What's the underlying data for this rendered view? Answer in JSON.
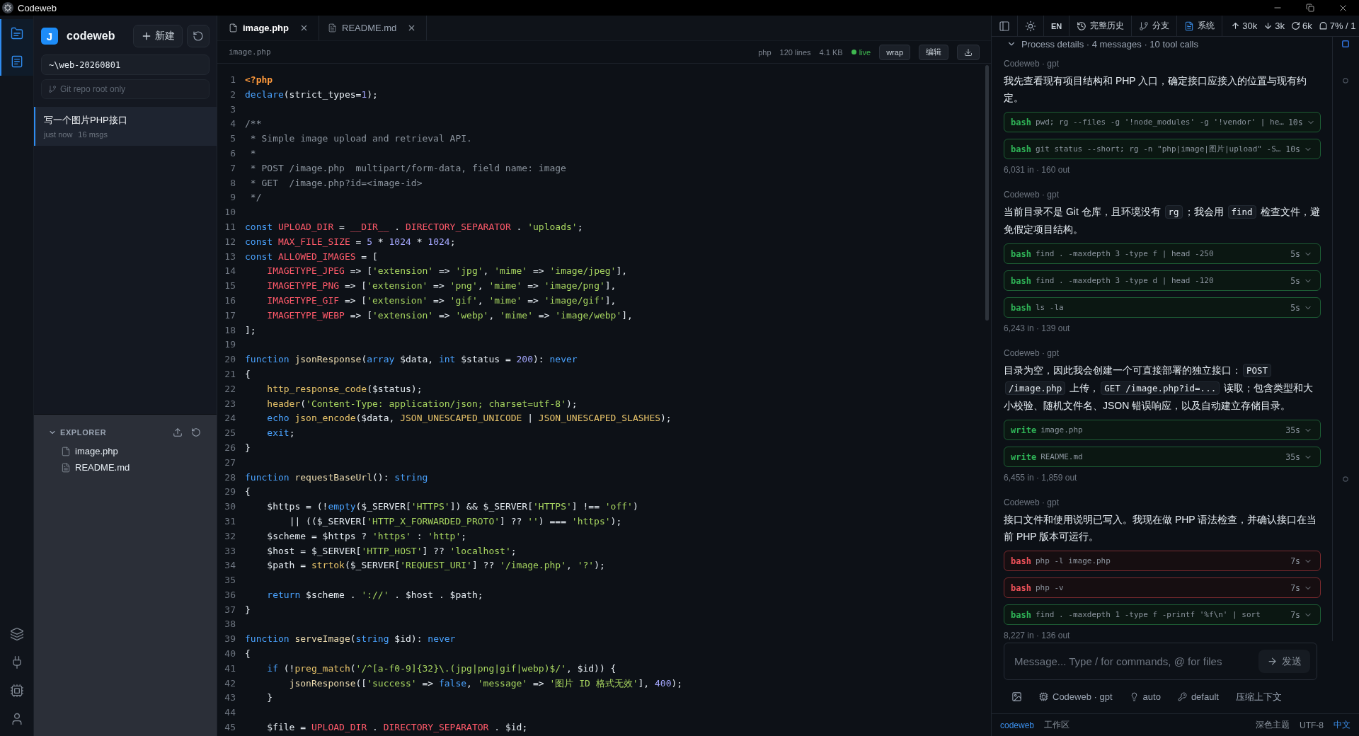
{
  "window": {
    "title": "Codeweb"
  },
  "activity_bar": {
    "top": [
      {
        "selected": true
      },
      {
        "selected": true
      }
    ],
    "bottom": [
      {
        "selected": false
      },
      {
        "selected": false
      },
      {
        "selected": false
      },
      {
        "selected": false
      }
    ]
  },
  "sidebar": {
    "logo": "J",
    "name": "codeweb",
    "new_button": "新建",
    "path_field": {
      "value": "~\\web-20260801"
    },
    "git_field": {
      "placeholder": "Git repo root only"
    },
    "sessions": [
      {
        "title": "写一个图片PHP接口",
        "time": "just now",
        "count": "16 msgs",
        "selected": true
      }
    ],
    "explorer": {
      "title": "EXPLORER",
      "expanded": true,
      "files": [
        {
          "name": "image.php",
          "kind": "php"
        },
        {
          "name": "README.md",
          "kind": "markdown"
        }
      ]
    }
  },
  "editor": {
    "tabs": [
      {
        "label": "image.php",
        "kind": "php",
        "selected": true
      },
      {
        "label": "README.md",
        "kind": "markdown",
        "selected": false
      }
    ],
    "path": "image.php",
    "info": [
      "php",
      "120 lines",
      "4.1 KB"
    ],
    "live": {
      "label": "live",
      "on": true
    },
    "buttons": [
      "wrap",
      "编辑"
    ],
    "lines": [
      {
        "number": "1",
        "tokens": [
          {
            "kind": "tag",
            "text": "<?php"
          }
        ]
      },
      {
        "number": "2",
        "tokens": [
          {
            "kind": "kw",
            "text": "declare"
          },
          {
            "kind": "p",
            "text": "(strict_types="
          },
          {
            "kind": "num",
            "text": "1"
          },
          {
            "kind": "p",
            "text": ");"
          }
        ]
      },
      {
        "number": "3"
      },
      {
        "number": "4",
        "tokens": [
          {
            "kind": "cm",
            "text": "/**"
          }
        ]
      },
      {
        "number": "5",
        "tokens": [
          {
            "kind": "cm",
            "text": " * Simple image upload and retrieval API."
          }
        ]
      },
      {
        "number": "6",
        "tokens": [
          {
            "kind": "cm",
            "text": " *"
          }
        ]
      },
      {
        "number": "7",
        "tokens": [
          {
            "kind": "cm",
            "text": " * POST /image.php  multipart/form-data, field name: image"
          }
        ]
      },
      {
        "number": "8",
        "tokens": [
          {
            "kind": "cm",
            "text": " * GET  /image.php?id=<image-id>"
          }
        ]
      },
      {
        "number": "9",
        "tokens": [
          {
            "kind": "cm",
            "text": " */"
          }
        ]
      },
      {
        "number": "10"
      },
      {
        "number": "11",
        "tokens": [
          {
            "kind": "kw",
            "text": "const"
          },
          {
            "kind": "const",
            "text": " UPLOAD_DIR"
          },
          {
            "kind": "p",
            "text": " = "
          },
          {
            "kind": "const",
            "text": "__DIR__"
          },
          {
            "kind": "p",
            "text": " . "
          },
          {
            "kind": "const",
            "text": "DIRECTORY_SEPARATOR"
          },
          {
            "kind": "p",
            "text": " . "
          },
          {
            "kind": "str",
            "text": "'uploads'"
          },
          {
            "kind": "p",
            "text": ";"
          }
        ]
      },
      {
        "number": "12",
        "tokens": [
          {
            "kind": "kw",
            "text": "const"
          },
          {
            "kind": "const",
            "text": " MAX_FILE_SIZE"
          },
          {
            "kind": "p",
            "text": " = "
          },
          {
            "kind": "num",
            "text": "5"
          },
          {
            "kind": "p",
            "text": " * "
          },
          {
            "kind": "num",
            "text": "1024"
          },
          {
            "kind": "p",
            "text": " * "
          },
          {
            "kind": "num",
            "text": "1024"
          },
          {
            "kind": "p",
            "text": ";"
          }
        ]
      },
      {
        "number": "13",
        "tokens": [
          {
            "kind": "kw",
            "text": "const"
          },
          {
            "kind": "const",
            "text": " ALLOWED_IMAGES"
          },
          {
            "kind": "p",
            "text": " = ["
          }
        ]
      },
      {
        "number": "14",
        "tokens": [
          {
            "kind": "const",
            "text": "    IMAGETYPE_JPEG"
          },
          {
            "kind": "p",
            "text": " => ["
          },
          {
            "kind": "str",
            "text": "'extension'"
          },
          {
            "kind": "p",
            "text": " => "
          },
          {
            "kind": "str",
            "text": "'jpg'"
          },
          {
            "kind": "p",
            "text": ", "
          },
          {
            "kind": "str",
            "text": "'mime'"
          },
          {
            "kind": "p",
            "text": " => "
          },
          {
            "kind": "str",
            "text": "'image/jpeg'"
          },
          {
            "kind": "p",
            "text": "],"
          }
        ]
      },
      {
        "number": "15",
        "tokens": [
          {
            "kind": "const",
            "text": "    IMAGETYPE_PNG"
          },
          {
            "kind": "p",
            "text": " => ["
          },
          {
            "kind": "str",
            "text": "'extension'"
          },
          {
            "kind": "p",
            "text": " => "
          },
          {
            "kind": "str",
            "text": "'png'"
          },
          {
            "kind": "p",
            "text": ", "
          },
          {
            "kind": "str",
            "text": "'mime'"
          },
          {
            "kind": "p",
            "text": " => "
          },
          {
            "kind": "str",
            "text": "'image/png'"
          },
          {
            "kind": "p",
            "text": "],"
          }
        ]
      },
      {
        "number": "16",
        "tokens": [
          {
            "kind": "const",
            "text": "    IMAGETYPE_GIF"
          },
          {
            "kind": "p",
            "text": " => ["
          },
          {
            "kind": "str",
            "text": "'extension'"
          },
          {
            "kind": "p",
            "text": " => "
          },
          {
            "kind": "str",
            "text": "'gif'"
          },
          {
            "kind": "p",
            "text": ", "
          },
          {
            "kind": "str",
            "text": "'mime'"
          },
          {
            "kind": "p",
            "text": " => "
          },
          {
            "kind": "str",
            "text": "'image/gif'"
          },
          {
            "kind": "p",
            "text": "],"
          }
        ]
      },
      {
        "number": "17",
        "tokens": [
          {
            "kind": "const",
            "text": "    IMAGETYPE_WEBP"
          },
          {
            "kind": "p",
            "text": " => ["
          },
          {
            "kind": "str",
            "text": "'extension'"
          },
          {
            "kind": "p",
            "text": " => "
          },
          {
            "kind": "str",
            "text": "'webp'"
          },
          {
            "kind": "p",
            "text": ", "
          },
          {
            "kind": "str",
            "text": "'mime'"
          },
          {
            "kind": "p",
            "text": " => "
          },
          {
            "kind": "str",
            "text": "'image/webp'"
          },
          {
            "kind": "p",
            "text": "],"
          }
        ]
      },
      {
        "number": "18",
        "tokens": [
          {
            "kind": "p",
            "text": "];"
          }
        ]
      },
      {
        "number": "19"
      },
      {
        "number": "20",
        "tokens": [
          {
            "kind": "kw",
            "text": "function"
          },
          {
            "kind": "def",
            "text": " jsonResponse"
          },
          {
            "kind": "p",
            "text": "("
          },
          {
            "kind": "kw",
            "text": "array"
          },
          {
            "kind": "p",
            "text": " $data, "
          },
          {
            "kind": "kw",
            "text": "int"
          },
          {
            "kind": "p",
            "text": " $status = "
          },
          {
            "kind": "num",
            "text": "200"
          },
          {
            "kind": "p",
            "text": "): "
          },
          {
            "kind": "kw",
            "text": "never"
          }
        ]
      },
      {
        "number": "21",
        "tokens": [
          {
            "kind": "p",
            "text": "{"
          }
        ]
      },
      {
        "number": "22",
        "tokens": [
          {
            "kind": "fn",
            "text": "    http_response_code"
          },
          {
            "kind": "p",
            "text": "($status);"
          }
        ]
      },
      {
        "number": "23",
        "tokens": [
          {
            "kind": "fn",
            "text": "    header"
          },
          {
            "kind": "p",
            "text": "("
          },
          {
            "kind": "str",
            "text": "'Content-Type: application/json; charset=utf-8'"
          },
          {
            "kind": "p",
            "text": ");"
          }
        ]
      },
      {
        "number": "24",
        "tokens": [
          {
            "kind": "kw",
            "text": "    echo"
          },
          {
            "kind": "fn",
            "text": " json_encode"
          },
          {
            "kind": "p",
            "text": "($data, "
          },
          {
            "kind": "fn",
            "text": "JSON_UNESCAPED_UNICODE"
          },
          {
            "kind": "p",
            "text": " | "
          },
          {
            "kind": "fn",
            "text": "JSON_UNESCAPED_SLASHES"
          },
          {
            "kind": "p",
            "text": ");"
          }
        ]
      },
      {
        "number": "25",
        "tokens": [
          {
            "kind": "kw",
            "text": "    exit"
          },
          {
            "kind": "p",
            "text": ";"
          }
        ]
      },
      {
        "number": "26",
        "tokens": [
          {
            "kind": "p",
            "text": "}"
          }
        ]
      },
      {
        "number": "27"
      },
      {
        "number": "28",
        "tokens": [
          {
            "kind": "kw",
            "text": "function"
          },
          {
            "kind": "def",
            "text": " requestBaseUrl"
          },
          {
            "kind": "p",
            "text": "(): "
          },
          {
            "kind": "kw",
            "text": "string"
          }
        ]
      },
      {
        "number": "29",
        "tokens": [
          {
            "kind": "p",
            "text": "{"
          }
        ]
      },
      {
        "number": "30",
        "tokens": [
          {
            "kind": "p",
            "text": "    $https = (!"
          },
          {
            "kind": "kw",
            "text": "empty"
          },
          {
            "kind": "p",
            "text": "($_SERVER["
          },
          {
            "kind": "str",
            "text": "'HTTPS'"
          },
          {
            "kind": "p",
            "text": "]) && $_SERVER["
          },
          {
            "kind": "str",
            "text": "'HTTPS'"
          },
          {
            "kind": "p",
            "text": "] !== "
          },
          {
            "kind": "str",
            "text": "'off'"
          },
          {
            "kind": "p",
            "text": ")"
          }
        ]
      },
      {
        "number": "31",
        "tokens": [
          {
            "kind": "p",
            "text": "        || (($_SERVER["
          },
          {
            "kind": "str",
            "text": "'HTTP_X_FORWARDED_PROTO'"
          },
          {
            "kind": "p",
            "text": "] ?? "
          },
          {
            "kind": "str",
            "text": "''"
          },
          {
            "kind": "p",
            "text": ") === "
          },
          {
            "kind": "str",
            "text": "'https'"
          },
          {
            "kind": "p",
            "text": ");"
          }
        ]
      },
      {
        "number": "32",
        "tokens": [
          {
            "kind": "p",
            "text": "    $scheme = $https ? "
          },
          {
            "kind": "str",
            "text": "'https'"
          },
          {
            "kind": "p",
            "text": " : "
          },
          {
            "kind": "str",
            "text": "'http'"
          },
          {
            "kind": "p",
            "text": ";"
          }
        ]
      },
      {
        "number": "33",
        "tokens": [
          {
            "kind": "p",
            "text": "    $host = $_SERVER["
          },
          {
            "kind": "str",
            "text": "'HTTP_HOST'"
          },
          {
            "kind": "p",
            "text": "] ?? "
          },
          {
            "kind": "str",
            "text": "'localhost'"
          },
          {
            "kind": "p",
            "text": ";"
          }
        ]
      },
      {
        "number": "34",
        "tokens": [
          {
            "kind": "p",
            "text": "    $path = "
          },
          {
            "kind": "fn",
            "text": "strtok"
          },
          {
            "kind": "p",
            "text": "($_SERVER["
          },
          {
            "kind": "str",
            "text": "'REQUEST_URI'"
          },
          {
            "kind": "p",
            "text": "] ?? "
          },
          {
            "kind": "str",
            "text": "'/image.php'"
          },
          {
            "kind": "p",
            "text": ", "
          },
          {
            "kind": "str",
            "text": "'?'"
          },
          {
            "kind": "p",
            "text": ");"
          }
        ]
      },
      {
        "number": "35"
      },
      {
        "number": "36",
        "tokens": [
          {
            "kind": "kw",
            "text": "    return"
          },
          {
            "kind": "p",
            "text": " $scheme . "
          },
          {
            "kind": "str",
            "text": "'://'"
          },
          {
            "kind": "p",
            "text": " . $host . $path;"
          }
        ]
      },
      {
        "number": "37",
        "tokens": [
          {
            "kind": "p",
            "text": "}"
          }
        ]
      },
      {
        "number": "38"
      },
      {
        "number": "39",
        "tokens": [
          {
            "kind": "kw",
            "text": "function"
          },
          {
            "kind": "def",
            "text": " serveImage"
          },
          {
            "kind": "p",
            "text": "("
          },
          {
            "kind": "kw",
            "text": "string"
          },
          {
            "kind": "p",
            "text": " $id): "
          },
          {
            "kind": "kw",
            "text": "never"
          }
        ]
      },
      {
        "number": "40",
        "tokens": [
          {
            "kind": "p",
            "text": "{"
          }
        ]
      },
      {
        "number": "41",
        "tokens": [
          {
            "kind": "kw",
            "text": "    if"
          },
          {
            "kind": "p",
            "text": " (!"
          },
          {
            "kind": "fn",
            "text": "preg_match"
          },
          {
            "kind": "p",
            "text": "("
          },
          {
            "kind": "str",
            "text": "'/^[a-f0-9]{32}\\.(jpg|png|gif|webp)$/'"
          },
          {
            "kind": "p",
            "text": ", $id)) {"
          }
        ]
      },
      {
        "number": "42",
        "tokens": [
          {
            "kind": "def",
            "text": "        jsonResponse"
          },
          {
            "kind": "p",
            "text": "(["
          },
          {
            "kind": "str",
            "text": "'success'"
          },
          {
            "kind": "p",
            "text": " => "
          },
          {
            "kind": "kw",
            "text": "false"
          },
          {
            "kind": "p",
            "text": ", "
          },
          {
            "kind": "str",
            "text": "'message'"
          },
          {
            "kind": "p",
            "text": " => "
          },
          {
            "kind": "str",
            "text": "'图片 ID 格式无效'"
          },
          {
            "kind": "p",
            "text": "], "
          },
          {
            "kind": "num",
            "text": "400"
          },
          {
            "kind": "p",
            "text": ");"
          }
        ]
      },
      {
        "number": "43",
        "tokens": [
          {
            "kind": "p",
            "text": "    }"
          }
        ]
      },
      {
        "number": "44"
      },
      {
        "number": "45",
        "tokens": [
          {
            "kind": "p",
            "text": "    $file = "
          },
          {
            "kind": "const",
            "text": "UPLOAD_DIR"
          },
          {
            "kind": "p",
            "text": " . "
          },
          {
            "kind": "const",
            "text": "DIRECTORY_SEPARATOR"
          },
          {
            "kind": "p",
            "text": " . $id;"
          }
        ]
      }
    ]
  },
  "chat": {
    "toolbar": {
      "lang": "EN",
      "buttons": [
        {
          "kind": "history",
          "label": "完整历史"
        },
        {
          "kind": "branch",
          "label": "分支"
        },
        {
          "kind": "system",
          "label": "系统"
        }
      ],
      "stats": [
        {
          "kind": "up",
          "value": "30k"
        },
        {
          "kind": "down",
          "value": "3k"
        },
        {
          "kind": "cache",
          "value": "6k"
        },
        {
          "kind": "context",
          "value": "7% / 1"
        }
      ]
    },
    "process": {
      "label": "Process details · 4 messages · 10 tool calls",
      "expanded": true
    },
    "messages": [
      {
        "author": "Codeweb · gpt",
        "text": [
          {
            "kind": "text",
            "text": "我先查看现有项目结构和 PHP 入口，确定接口应接入的位置与现有约定。"
          }
        ],
        "tools": [
          {
            "tool": "bash",
            "command": "pwd; rg --files -g '!node_modules' -g '!vendor' | he…",
            "duration": "10s",
            "failed": false
          },
          {
            "tool": "bash",
            "command": "git status --short; rg -n \"php|image|图片|upload\" -S…",
            "duration": "10s",
            "failed": false
          }
        ],
        "usage": "6,031 in · 160 out"
      },
      {
        "author": "Codeweb · gpt",
        "text": [
          {
            "kind": "text",
            "text": "当前目录不是 Git 仓库，且环境没有 "
          },
          {
            "kind": "code",
            "text": "rg"
          },
          {
            "kind": "text",
            "text": "；我会用 "
          },
          {
            "kind": "code",
            "text": "find"
          },
          {
            "kind": "text",
            "text": " 检查文件，避免假定项目结构。"
          }
        ],
        "tools": [
          {
            "tool": "bash",
            "command": "find . -maxdepth 3 -type f | head -250",
            "duration": "5s",
            "failed": false
          },
          {
            "tool": "bash",
            "command": "find . -maxdepth 3 -type d | head -120",
            "duration": "5s",
            "failed": false
          },
          {
            "tool": "bash",
            "command": "ls -la",
            "duration": "5s",
            "failed": false
          }
        ],
        "usage": "6,243 in · 139 out"
      },
      {
        "author": "Codeweb · gpt",
        "text": [
          {
            "kind": "text",
            "text": "目录为空，因此我会创建一个可直接部署的独立接口："
          },
          {
            "kind": "code",
            "text": "POST /image.php"
          },
          {
            "kind": "text",
            "text": " 上传，"
          },
          {
            "kind": "code",
            "text": "GET /image.php?id=..."
          },
          {
            "kind": "text",
            "text": " 读取；包含类型和大小校验、随机文件名、JSON 错误响应，以及自动建立存储目录。"
          }
        ],
        "tools": [
          {
            "tool": "write",
            "command": "image.php",
            "duration": "35s",
            "failed": false
          },
          {
            "tool": "write",
            "command": "README.md",
            "duration": "35s",
            "failed": false
          }
        ],
        "usage": "6,455 in · 1,859 out"
      },
      {
        "author": "Codeweb · gpt",
        "text": [
          {
            "kind": "text",
            "text": "接口文件和使用说明已写入。我现在做 PHP 语法检查，并确认接口在当前 PHP 版本可运行。"
          }
        ],
        "tools": [
          {
            "tool": "bash",
            "command": "php -l image.php",
            "duration": "7s",
            "failed": true
          },
          {
            "tool": "bash",
            "command": "php -v",
            "duration": "7s",
            "failed": true
          },
          {
            "tool": "bash",
            "command": "find . -maxdepth 1 -type f -printf '%f\\n' | sort",
            "duration": "7s",
            "failed": false
          }
        ],
        "usage": "8,227 in · 136 out"
      }
    ],
    "composer": {
      "placeholder": "Message... Type / for commands, @ for files",
      "send": "发送",
      "model": "Codeweb · gpt",
      "mode": "auto",
      "profile": "default",
      "context": "压缩上下文"
    },
    "status_bar": {
      "left": [
        {
          "text": "codeweb",
          "color": "#3b8eea"
        },
        {
          "text": "工作区",
          "color": "#8b949e"
        }
      ],
      "right": [
        {
          "text": "深色主题",
          "color": "#8b949e"
        },
        {
          "text": "UTF-8",
          "color": "#8b949e"
        },
        {
          "text": "中文",
          "color": "#3b8eea"
        }
      ]
    }
  }
}
